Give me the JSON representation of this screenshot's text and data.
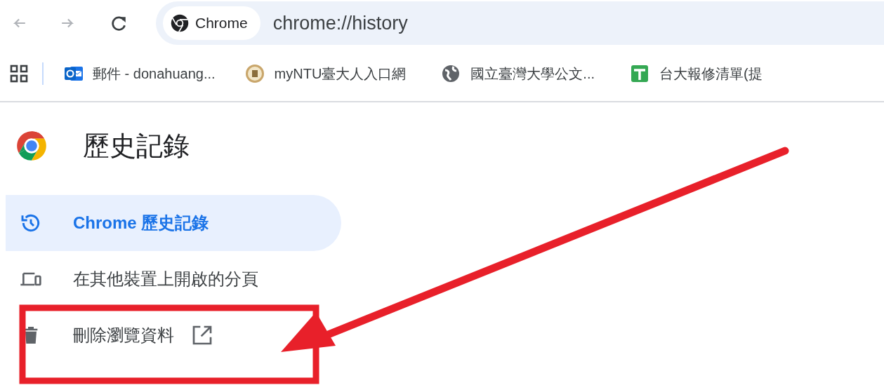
{
  "toolbar": {
    "chip_label": "Chrome",
    "url": "chrome://history"
  },
  "bookmarks": [
    {
      "label": "郵件 - donahuang..."
    },
    {
      "label": "myNTU臺大人入口網"
    },
    {
      "label": "國立臺灣大學公文..."
    },
    {
      "label": "台大報修清單(提"
    }
  ],
  "page_title": "歷史記錄",
  "sidebar": {
    "items": [
      {
        "label": "Chrome 歷史記錄",
        "selected": true,
        "external": false
      },
      {
        "label": "在其他裝置上開啟的分頁",
        "selected": false,
        "external": false
      },
      {
        "label": "刪除瀏覽資料",
        "selected": false,
        "external": true
      }
    ]
  }
}
